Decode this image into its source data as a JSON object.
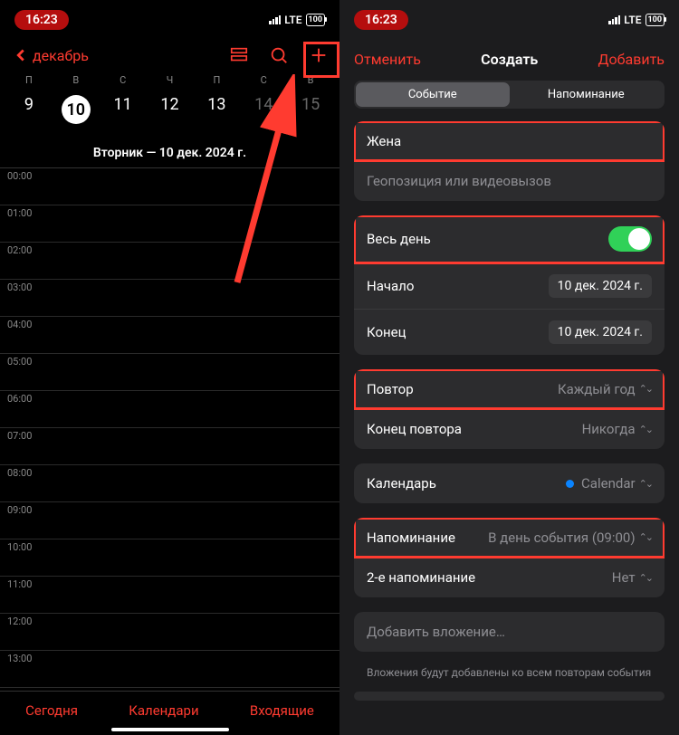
{
  "status": {
    "time": "16:23",
    "net": "LTE",
    "battery": "100"
  },
  "left": {
    "month_back": "декабрь",
    "weekdays": [
      "П",
      "В",
      "С",
      "Ч",
      "П",
      "С",
      "В"
    ],
    "days": [
      "9",
      "10",
      "11",
      "12",
      "13",
      "14",
      "15"
    ],
    "day_title": "Вторник — 10 дек. 2024 г.",
    "hours": [
      "00:00",
      "01:00",
      "02:00",
      "03:00",
      "04:00",
      "05:00",
      "06:00",
      "07:00",
      "08:00",
      "09:00",
      "10:00",
      "11:00",
      "12:00",
      "13:00"
    ],
    "tabs": {
      "today": "Сегодня",
      "calendars": "Календари",
      "inbox": "Входящие"
    }
  },
  "right": {
    "cancel": "Отменить",
    "title": "Создать",
    "add": "Добавить",
    "seg": {
      "event": "Событие",
      "reminder": "Напоминание"
    },
    "title_field": "Жена",
    "location_ph": "Геопозиция или видеовызов",
    "all_day": "Весь день",
    "start_label": "Начало",
    "start_value": "10 дек. 2024 г.",
    "end_label": "Конец",
    "end_value": "10 дек. 2024 г.",
    "repeat_label": "Повтор",
    "repeat_value": "Каждый год",
    "repeat_end_label": "Конец повтора",
    "repeat_end_value": "Никогда",
    "calendar_label": "Календарь",
    "calendar_value": "Calendar",
    "alert_label": "Напоминание",
    "alert_value": "В день события (09:00)",
    "alert2_label": "2-е напоминание",
    "alert2_value": "Нет",
    "attach_label": "Добавить вложение…",
    "attach_note": "Вложения будут добавлены ко всем повторам события"
  }
}
